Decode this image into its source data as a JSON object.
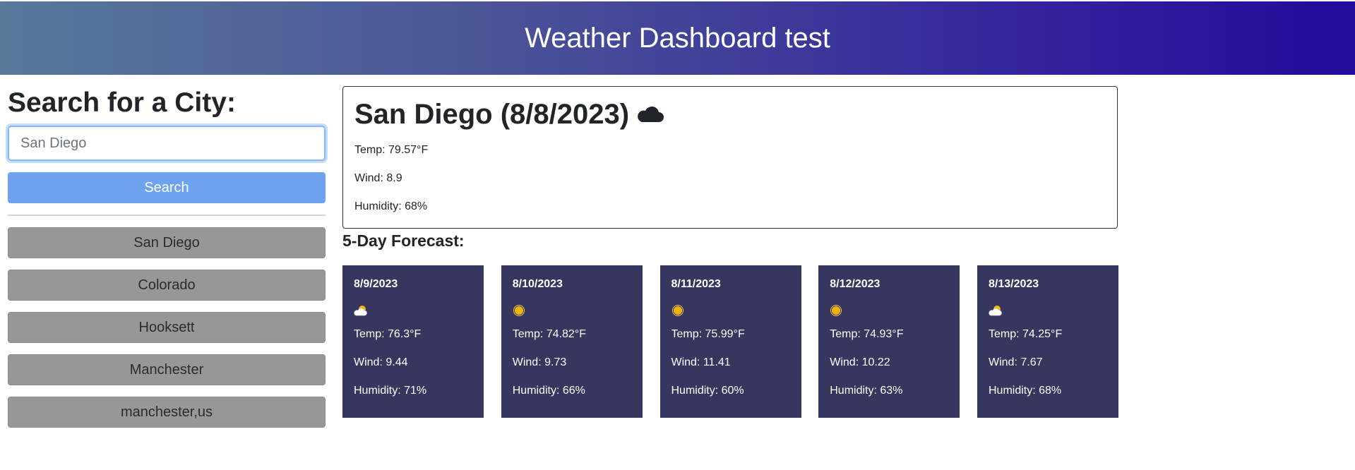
{
  "header": {
    "title": "Weather Dashboard test"
  },
  "sidebar": {
    "heading": "Search for a City:",
    "search": {
      "value": "",
      "placeholder": "San Diego"
    },
    "search_button_label": "Search",
    "history": [
      "San Diego",
      "Colorado",
      "Hooksett",
      "Manchester",
      "manchester,us"
    ]
  },
  "current": {
    "title": "San Diego (8/8/2023)",
    "icon": "cloud-icon",
    "temp": "Temp: 79.57°F",
    "wind": "Wind: 8.9",
    "humidity": "Humidity: 68%"
  },
  "forecast": {
    "title": "5-Day Forecast:",
    "days": [
      {
        "date": "8/9/2023",
        "icon": "partly-cloudy-icon",
        "temp": "Temp: 76.3°F",
        "wind": "Wind: 9.44",
        "humidity": "Humidity: 71%"
      },
      {
        "date": "8/10/2023",
        "icon": "sun-icon",
        "temp": "Temp: 74.82°F",
        "wind": "Wind: 9.73",
        "humidity": "Humidity: 66%"
      },
      {
        "date": "8/11/2023",
        "icon": "sun-icon",
        "temp": "Temp: 75.99°F",
        "wind": "Wind: 11.41",
        "humidity": "Humidity: 60%"
      },
      {
        "date": "8/12/2023",
        "icon": "sun-icon",
        "temp": "Temp: 74.93°F",
        "wind": "Wind: 10.22",
        "humidity": "Humidity: 63%"
      },
      {
        "date": "8/13/2023",
        "icon": "partly-cloudy-icon",
        "temp": "Temp: 74.25°F",
        "wind": "Wind: 7.67",
        "humidity": "Humidity: 68%"
      }
    ]
  },
  "colors": {
    "header_gradient_start": "#57799a",
    "header_gradient_end": "#24099b",
    "search_button": "#6fa3ef",
    "history_button": "#979797",
    "forecast_card": "#36365e"
  }
}
